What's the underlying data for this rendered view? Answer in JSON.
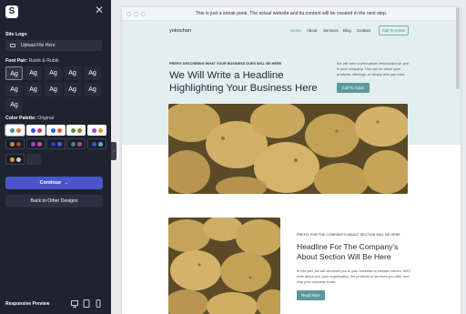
{
  "sidebar": {
    "logo_icon": "s-logo-icon",
    "close_icon": "close-icon",
    "site_logo_label": "Site Logo",
    "upload_label": "Upload File Here",
    "font_pair_label": "Font Pair:",
    "font_pair_value": "Rubik & Rubik",
    "font_samples": [
      "Ag",
      "Ag",
      "Ag",
      "Ag",
      "Ag",
      "Ag",
      "Ag",
      "Ag",
      "Ag",
      "Ag",
      "Ag"
    ],
    "color_palette_label": "Color Palette:",
    "color_palette_value": "Original",
    "palettes": [
      {
        "colors": [
          "#3a8f8f",
          "#e07a3c"
        ]
      },
      {
        "colors": [
          "#3b4bd3",
          "#d23a6f"
        ]
      },
      {
        "colors": [
          "#2f5fd6",
          "#e65b3b"
        ]
      },
      {
        "colors": [
          "#5d8f3b",
          "#a8763a"
        ]
      },
      {
        "colors": [
          "#9a4bc4",
          "#d0a43a"
        ]
      },
      {
        "colors": [
          "#d8823a",
          "#b33a3a"
        ]
      },
      {
        "colors": [
          "#9a4bbf",
          "#d44c8c"
        ]
      },
      {
        "colors": [
          "#2840c9",
          "#4a5fe0"
        ]
      },
      {
        "colors": [
          "#3c8f6f",
          "#c44a7c"
        ]
      },
      {
        "colors": [
          "#4a4fc4",
          "#59b7d8"
        ]
      },
      {
        "colors": [
          "#e0a030",
          "#c9c9c9"
        ]
      }
    ],
    "continue_label": "Continue",
    "continue_icon": "arrow-right-icon",
    "back_label": "Back to Other Designs",
    "responsive_label": "Responsive Preview",
    "device_icons": [
      "desktop-icon",
      "tablet-icon",
      "mobile-icon"
    ]
  },
  "preview": {
    "sneak_text": "This is just a sneak peek. The actual website and its content will be created in the next step.",
    "brand": "yokochan",
    "nav": [
      "Home",
      "About",
      "Services",
      "Blog",
      "Contact"
    ],
    "nav_cta": "Call To Action",
    "hero_prefix": "PREFIX DESCRIBING WHAT YOUR BUSINESS DOES WILL BE HERE",
    "hero_headline": "We Will Write a Headline Highlighting Your Business Here",
    "hero_intro": "We will write a persuasive introduction for you in your company. This can be about your products, offerings, or simply who you exist.",
    "hero_cta": "Call To Action",
    "about_prefix": "PREFIX FOR THE COMPANY'S ABOUT SECTION WILL BE HERE",
    "about_headline": "Headline For The Company's About Section Will Be Here",
    "about_body": "In this part, we will introduce you to your business to website visitors. We'll write about you, your organization, the products or services you offer, and why your company exists.",
    "about_cta": "Read More"
  }
}
